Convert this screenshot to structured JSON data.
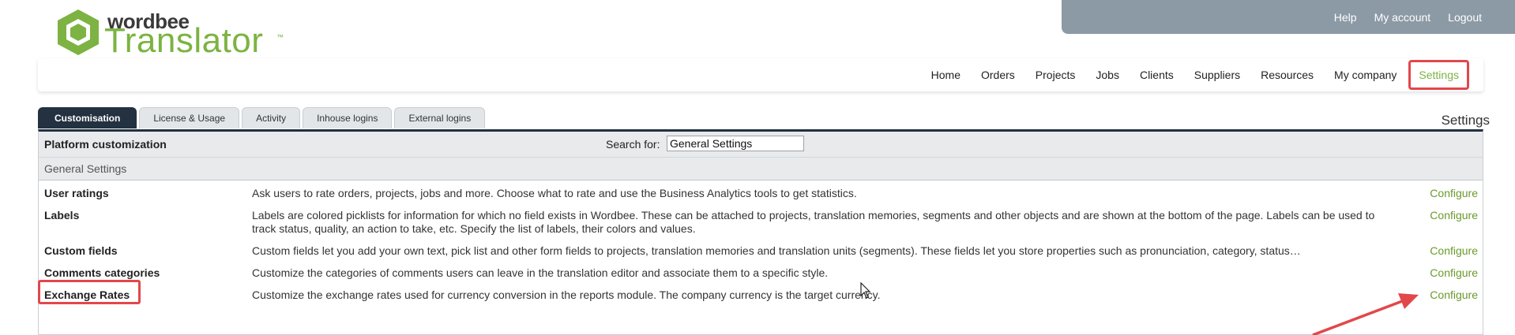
{
  "logo": {
    "small": "wordbee",
    "big": "Translator",
    "tm": "™"
  },
  "account": {
    "help": "Help",
    "my_account": "My account",
    "logout": "Logout"
  },
  "nav": [
    "Home",
    "Orders",
    "Projects",
    "Jobs",
    "Clients",
    "Suppliers",
    "Resources",
    "My company",
    "Settings"
  ],
  "active_nav": "Settings",
  "tabs": [
    "Customisation",
    "License & Usage",
    "Activity",
    "Inhouse logins",
    "External logins"
  ],
  "page_title": "Settings",
  "panel": {
    "title": "Platform customization",
    "search_label": "Search for:",
    "search_value": "General Settings",
    "section": "General Settings"
  },
  "rows": [
    {
      "name": "User ratings",
      "desc": "Ask users to rate orders, projects, jobs and more. Choose what to rate and use the Business Analytics tools to get statistics.",
      "action": "Configure"
    },
    {
      "name": "Labels",
      "desc": "Labels are colored picklists for information for which no field exists in Wordbee. These can be attached to projects, translation memories, segments and other objects and are shown at the bottom of the page. Labels can be used to track status, quality, an action to take, etc. Specify the list of labels, their colors and values.",
      "action": "Configure"
    },
    {
      "name": "Custom fields",
      "desc": "Custom fields let you add your own text, pick list and other form fields to projects, translation memories and translation units (segments). These fields let you store properties such as pronunciation, category, status…",
      "action": "Configure"
    },
    {
      "name": "Comments categories",
      "desc": "Customize the categories of comments users can leave in the translation editor and associate them to a specific style.",
      "action": "Configure"
    },
    {
      "name": "Exchange Rates",
      "desc": "Customize the exchange rates used for currency conversion in the reports module. The company currency is the target currency.",
      "action": "Configure"
    }
  ],
  "colors": {
    "accent": "#7cb342",
    "highlight": "#e2474b",
    "dark": "#233140",
    "bar": "#8c9aa6"
  }
}
